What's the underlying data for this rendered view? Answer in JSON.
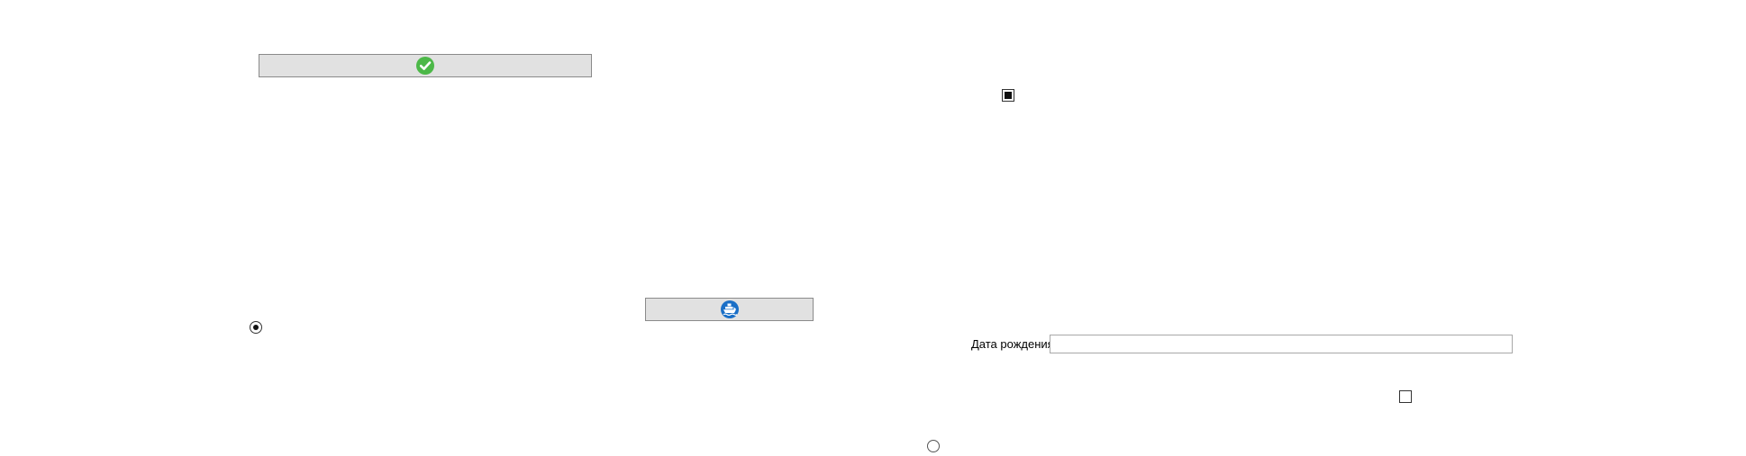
{
  "buttons": {
    "confirm": {
      "icon": "green-checkmark-icon"
    },
    "ship": {
      "icon": "blue-ship-icon"
    }
  },
  "controls": {
    "radio_1": {
      "checked": true
    },
    "radio_2": {
      "checked": false
    },
    "checkbox_1": {
      "state": "indeterminate"
    },
    "checkbox_2": {
      "state": "unchecked"
    }
  },
  "birth_date": {
    "label": "Дата рождения",
    "value": ""
  },
  "colors": {
    "button_bg": "#e1e1e1",
    "check_green": "#4cb848",
    "ship_blue": "#1a6fc7"
  }
}
